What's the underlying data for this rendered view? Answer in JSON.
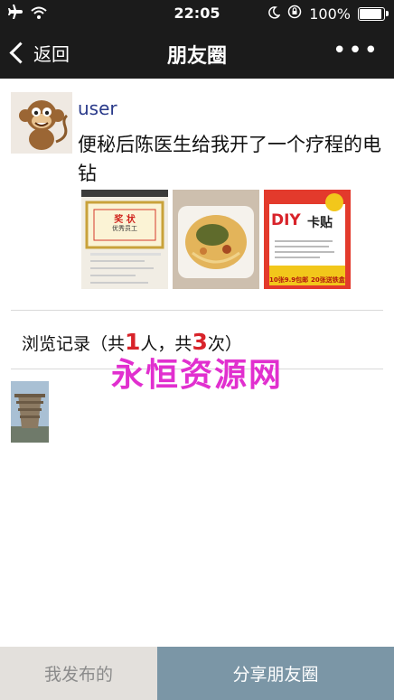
{
  "status_bar": {
    "time": "22:05",
    "battery_text": "100%",
    "battery_level": 1.0,
    "icons": [
      "airplane-icon",
      "wifi-icon",
      "moon-icon",
      "orientation-lock-icon",
      "battery-icon"
    ]
  },
  "nav": {
    "back_label": "返回",
    "title": "朋友圈",
    "more_label": "•••"
  },
  "post": {
    "username": "user",
    "text": "便秘后陈医生给我开了一个疗程的电钻",
    "photos": [
      {
        "name": "certificate-photo",
        "caption_top": "奖 状",
        "caption_sub": "优秀员工"
      },
      {
        "name": "food-photo"
      },
      {
        "name": "diy-card-photo",
        "headline": "DIY",
        "headline2": "卡贴",
        "footer_left": "10张9.9包邮",
        "footer_right": "20张送铁盒"
      }
    ]
  },
  "browse": {
    "prefix": "浏览记录（共",
    "person_count": "1",
    "mid": "人，共",
    "view_count": "3",
    "suffix": "次）"
  },
  "watermark": "永恒资源网",
  "bottom": {
    "my_posts_label": "我发布的",
    "share_label": "分享朋友圈"
  },
  "colors": {
    "header_bg": "#1b1b1b",
    "username": "#2a3a8a",
    "count_red": "#d8232a",
    "watermark": "#e12fcf",
    "share_button": "#7b96a6",
    "my_posts_button": "#e3e0dc"
  }
}
